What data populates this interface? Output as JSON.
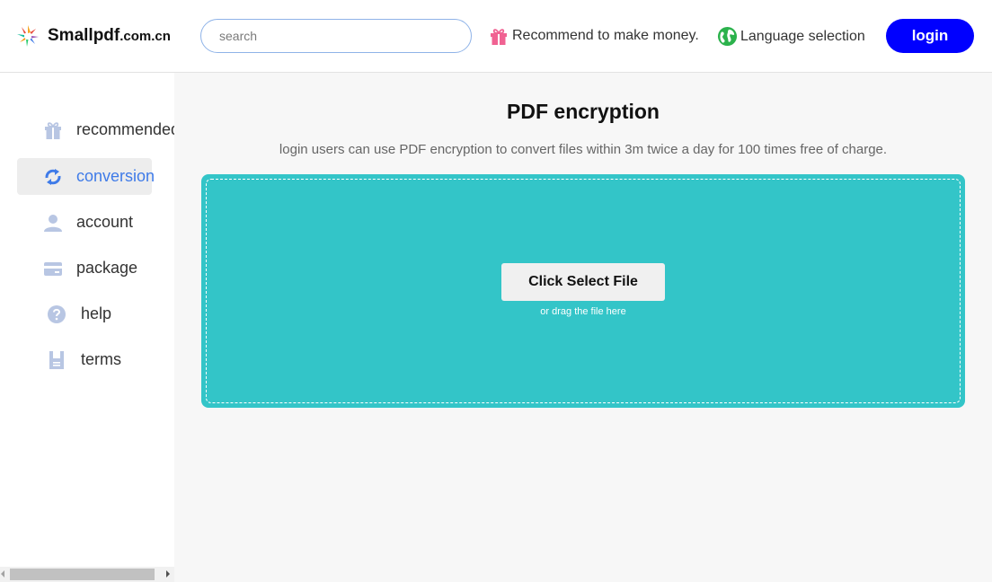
{
  "header": {
    "logo_text": "Smallpdf",
    "logo_suffix": ".com.cn",
    "search_placeholder": "search",
    "recommend_label": "Recommend to make money.",
    "language_label": "Language selection",
    "login_label": "login",
    "login_color": "#0000ff"
  },
  "sidebar": {
    "items": [
      {
        "label": "recommended",
        "icon": "gift-icon",
        "active": false
      },
      {
        "label": "conversion",
        "icon": "convert-icon",
        "active": true
      },
      {
        "label": "account",
        "icon": "user-icon",
        "active": false
      },
      {
        "label": "package",
        "icon": "card-icon",
        "active": false
      },
      {
        "label": "help",
        "icon": "help-icon",
        "active": false
      },
      {
        "label": "terms",
        "icon": "document-icon",
        "active": false
      }
    ],
    "active_color": "#3f7be8"
  },
  "main": {
    "title": "PDF encryption",
    "subtitle": "login users can use PDF encryption to convert files within 3m twice a day for 100 times free of charge.",
    "select_button": "Click Select File",
    "drag_hint": "or drag the file here",
    "dropzone_color": "#33c5c8"
  }
}
